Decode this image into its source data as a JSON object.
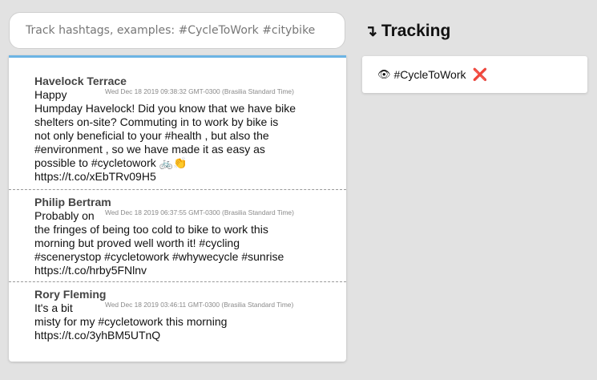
{
  "search": {
    "placeholder": "Track hashtags, examples: #CycleToWork #citybike",
    "value": ""
  },
  "feed": {
    "tweets": [
      {
        "author": "Havelock Terrace",
        "timestamp": "Wed Dec 18 2019 09:38:32 GMT-0300 (Brasilia Standard Time)",
        "lines": [
          "Happy",
          "Humpday Havelock! Did you know that we have bike",
          "shelters on-site? Commuting in to work by bike is",
          "not only beneficial to your #health , but also the",
          "#environment , so we have made it as easy as",
          "possible to #cycletowork 🚲👏",
          "https://t.co/xEbTRv09H5"
        ]
      },
      {
        "author": "Philip Bertram",
        "timestamp": "Wed Dec 18 2019 06:37:55 GMT-0300 (Brasilia Standard Time)",
        "lines": [
          "Probably on",
          "the fringes of being too cold to bike to work this",
          "morning but proved well worth it! #cycling",
          "#scenerystop #cycletowork #whywecycle #sunrise",
          "https://t.co/hrby5FNlnv"
        ]
      },
      {
        "author": "Rory Fleming",
        "timestamp": "Wed Dec 18 2019 03:46:11 GMT-0300 (Brasilia Standard Time)",
        "lines": [
          "It's a bit",
          "misty for my #cycletowork this morning",
          "https://t.co/3yhBM5UTnQ"
        ]
      }
    ]
  },
  "tracking": {
    "arrow": "↴",
    "title": "Tracking",
    "tags": [
      {
        "eye": "👁",
        "label": "#CycleToWork",
        "remove": "❌"
      }
    ]
  },
  "colors": {
    "background": "#e2e2e2",
    "feed_accent": "#6cb4e4",
    "remove": "#d9261c"
  }
}
